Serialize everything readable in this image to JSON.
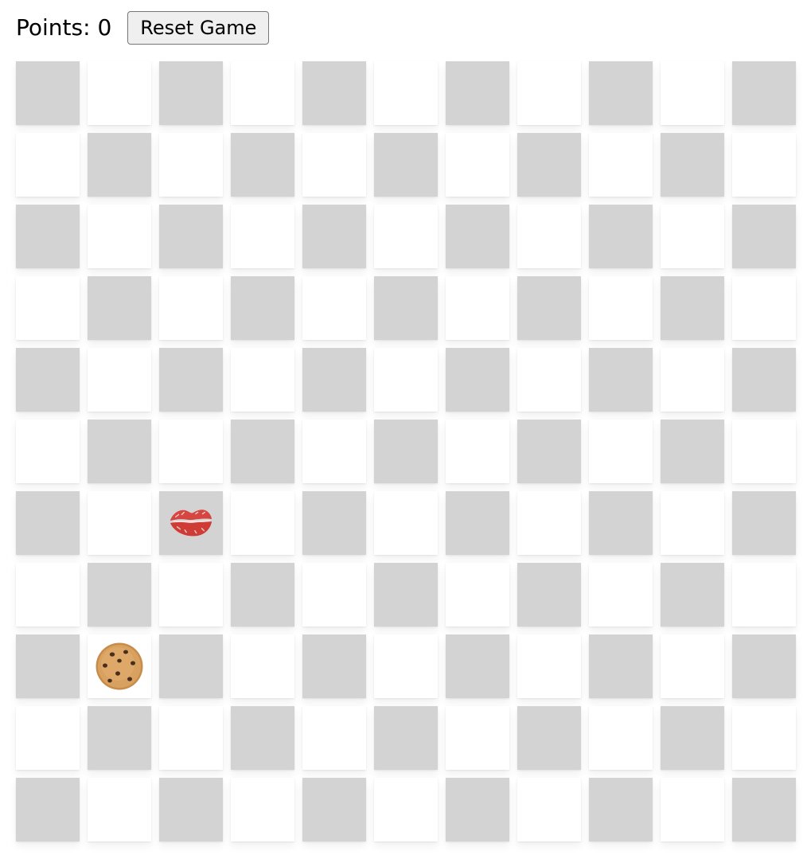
{
  "header": {
    "points_label": "Points: 0",
    "reset_label": "Reset Game"
  },
  "board": {
    "rows": 11,
    "cols": 11,
    "colors": {
      "dark": "#d3d3d3",
      "light": "#ffffff"
    },
    "items": [
      {
        "type": "kiss-mark",
        "row": 6,
        "col": 2
      },
      {
        "type": "cookie",
        "row": 8,
        "col": 1
      }
    ]
  }
}
